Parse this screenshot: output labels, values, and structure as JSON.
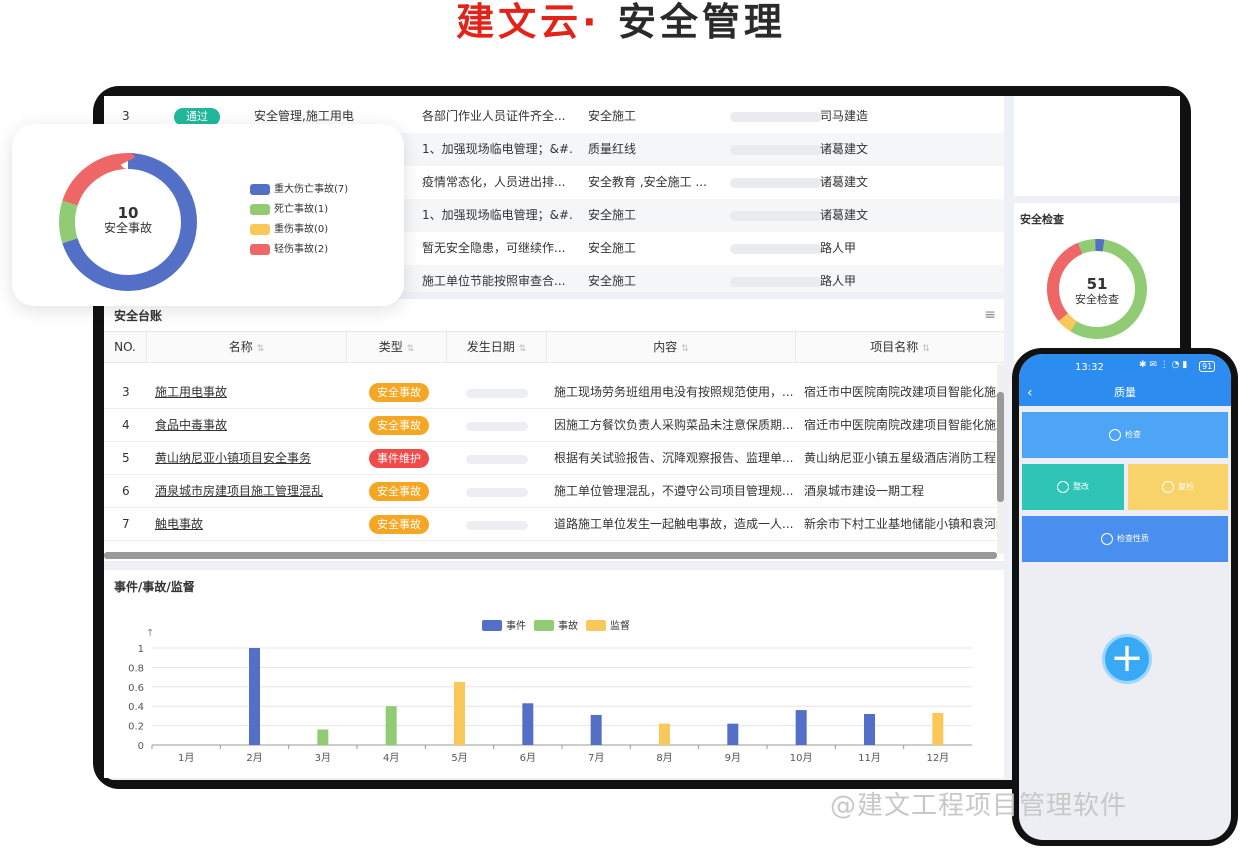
{
  "brand": {
    "part1": "建文云",
    "dot": "·",
    "part2": "安全管理"
  },
  "top_table": {
    "rows": [
      {
        "no": "3",
        "status": "通过",
        "name": "安全管理,施工用电",
        "content": "各部门作业人员证件齐全...",
        "type": "安全施工",
        "company": "司马建造"
      },
      {
        "no": "",
        "status": "",
        "name": "",
        "content": "1、加强现场临电管理；&#...",
        "type": "质量红线",
        "company": "诸葛建文"
      },
      {
        "no": "",
        "status": "",
        "name": "",
        "content": "疫情常态化，人员进出排...",
        "type": "安全教育 ,安全施工 ...",
        "company": "诸葛建文"
      },
      {
        "no": "",
        "status": "",
        "name": "",
        "content": "1、加强现场临电管理；&#...",
        "type": "安全施工",
        "company": "诸葛建文"
      },
      {
        "no": "",
        "status": "",
        "name": "",
        "content": "暂无安全隐患，可继续作...",
        "type": "安全施工",
        "company": "路人甲"
      },
      {
        "no": "",
        "status": "",
        "name": "",
        "content": "施工单位节能按照审查合...",
        "type": "安全施工",
        "company": "路人甲"
      }
    ]
  },
  "check_panel": {
    "title": "安全检查",
    "count": "51",
    "label": "安全检查"
  },
  "donut_card": {
    "count": "10",
    "label": "安全事故",
    "legend": [
      {
        "label": "重大伤亡事故(7)",
        "color": "#5470c6",
        "value": 7
      },
      {
        "label": "死亡事故(1)",
        "color": "#91cc75",
        "value": 1
      },
      {
        "label": "重伤事故(0)",
        "color": "#fac858",
        "value": 0
      },
      {
        "label": "轻伤事故(2)",
        "color": "#ee6666",
        "value": 2
      }
    ]
  },
  "ledger": {
    "title": "安全台账",
    "menu_icon": "≡",
    "columns": [
      "NO.",
      "名称",
      "类型",
      "发生日期",
      "内容",
      "项目名称"
    ],
    "sort_icon": "⇅",
    "rows": [
      {
        "no": "3",
        "name": "施工用电事故",
        "tag": "安全事故",
        "tag_kind": "accident",
        "content": "施工现场劳务班组用电没有按照规范使用，...",
        "project": "宿迁市中医院南院改建项目智能化施工"
      },
      {
        "no": "4",
        "name": "食品中毒事故",
        "tag": "安全事故",
        "tag_kind": "accident",
        "content": "因施工方餐饮负责人采购菜品未注意保质期...",
        "project": "宿迁市中医院南院改建项目智能化施工"
      },
      {
        "no": "5",
        "name": "黄山纳尼亚小镇项目安全事务",
        "tag": "事件维护",
        "tag_kind": "event",
        "content": "根据有关试验报告、沉降观察报告、监理单...",
        "project": "黄山纳尼亚小镇五星级酒店消防工程"
      },
      {
        "no": "6",
        "name": "酒泉城市房建项目施工管理混乱",
        "tag": "安全事故",
        "tag_kind": "accident",
        "content": "施工单位管理混乱，不遵守公司项目管理规...",
        "project": "酒泉城市建设一期工程"
      },
      {
        "no": "7",
        "name": "触电事故",
        "tag": "安全事故",
        "tag_kind": "accident",
        "content": "道路施工单位发生一起触电事故，造成一人...",
        "project": "新余市下村工业基地储能小镇和袁河绿"
      }
    ]
  },
  "chart_panel": {
    "title": "事件/事故/监督"
  },
  "chart_data": {
    "type": "bar",
    "title": "",
    "xlabel": "",
    "ylabel": "",
    "ylim": [
      0,
      1
    ],
    "yticks": [
      "0",
      "0.2",
      "0.4",
      "0.6",
      "0.8",
      "1"
    ],
    "grid": true,
    "legend_position": "top-center",
    "categories": [
      "1月",
      "2月",
      "3月",
      "4月",
      "5月",
      "6月",
      "7月",
      "8月",
      "9月",
      "10月",
      "11月",
      "12月"
    ],
    "series": [
      {
        "name": "事件",
        "color": "#5470c6",
        "values": [
          0,
          1.0,
          0,
          0,
          0,
          0.43,
          0.31,
          0,
          0.22,
          0.36,
          0.32,
          0
        ]
      },
      {
        "name": "事故",
        "color": "#91cc75",
        "values": [
          0,
          0,
          0.16,
          0.4,
          0,
          0,
          0,
          0,
          0,
          0,
          0,
          0
        ]
      },
      {
        "name": "监督",
        "color": "#fac858",
        "values": [
          0,
          0,
          0,
          0,
          0.65,
          0,
          0,
          0.22,
          0,
          0,
          0,
          0.33
        ]
      }
    ]
  },
  "phone": {
    "time": "13:32",
    "battery": "91",
    "back_icon": "‹",
    "title": "质量",
    "tiles": {
      "check": "检查",
      "rectify": "整改",
      "review": "复检",
      "nature": "检查性质"
    },
    "fab": "+"
  },
  "watermark": "@建文工程项目管理软件"
}
